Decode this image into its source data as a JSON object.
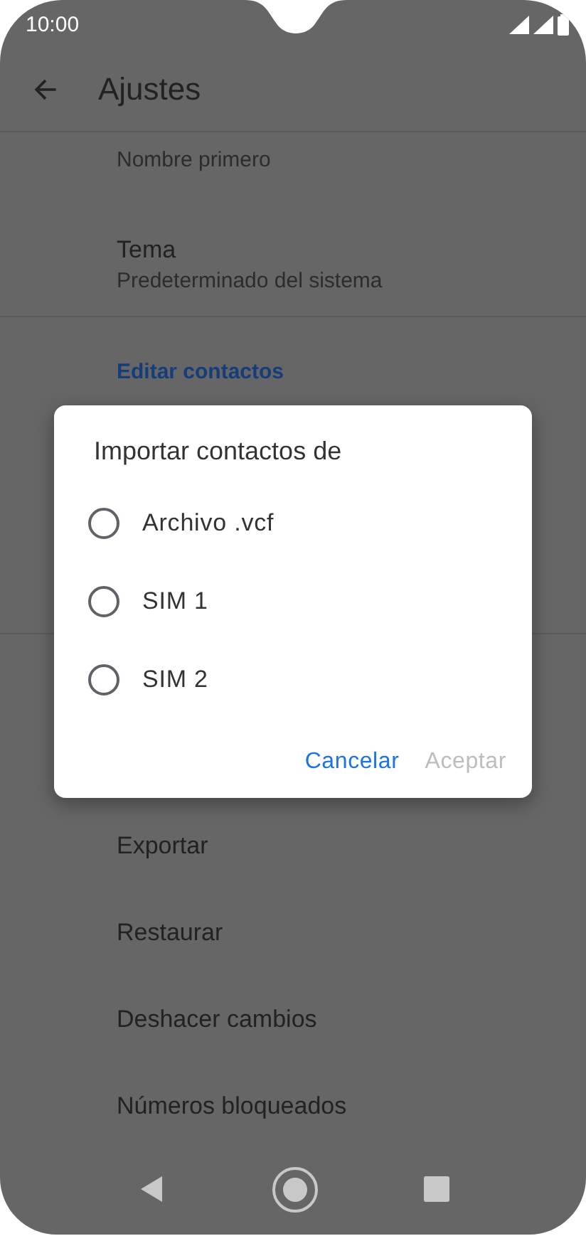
{
  "status_bar": {
    "time": "10:00"
  },
  "toolbar": {
    "title": "Ajustes"
  },
  "settings": [
    {
      "kind": "value",
      "subtitle": "Nombre primero"
    },
    {
      "kind": "value",
      "title": "Tema",
      "subtitle": "Predeterminado del sistema"
    },
    {
      "kind": "divider"
    },
    {
      "kind": "header",
      "title": "Editar contactos"
    },
    {
      "kind": "hidden"
    },
    {
      "kind": "divider"
    },
    {
      "kind": "hidden"
    },
    {
      "kind": "item",
      "title": "Exportar"
    },
    {
      "kind": "item",
      "title": "Restaurar"
    },
    {
      "kind": "item",
      "title": "Deshacer cambios"
    },
    {
      "kind": "item",
      "title": "Números bloqueados"
    }
  ],
  "dialog": {
    "title": "Importar contactos de",
    "options": [
      {
        "label": "Archivo .vcf",
        "selected": false
      },
      {
        "label": "SIM 1",
        "selected": false
      },
      {
        "label": "SIM 2",
        "selected": false
      }
    ],
    "buttons": [
      {
        "label": "Cancelar",
        "disabled": false
      },
      {
        "label": "Aceptar",
        "disabled": true
      }
    ]
  }
}
